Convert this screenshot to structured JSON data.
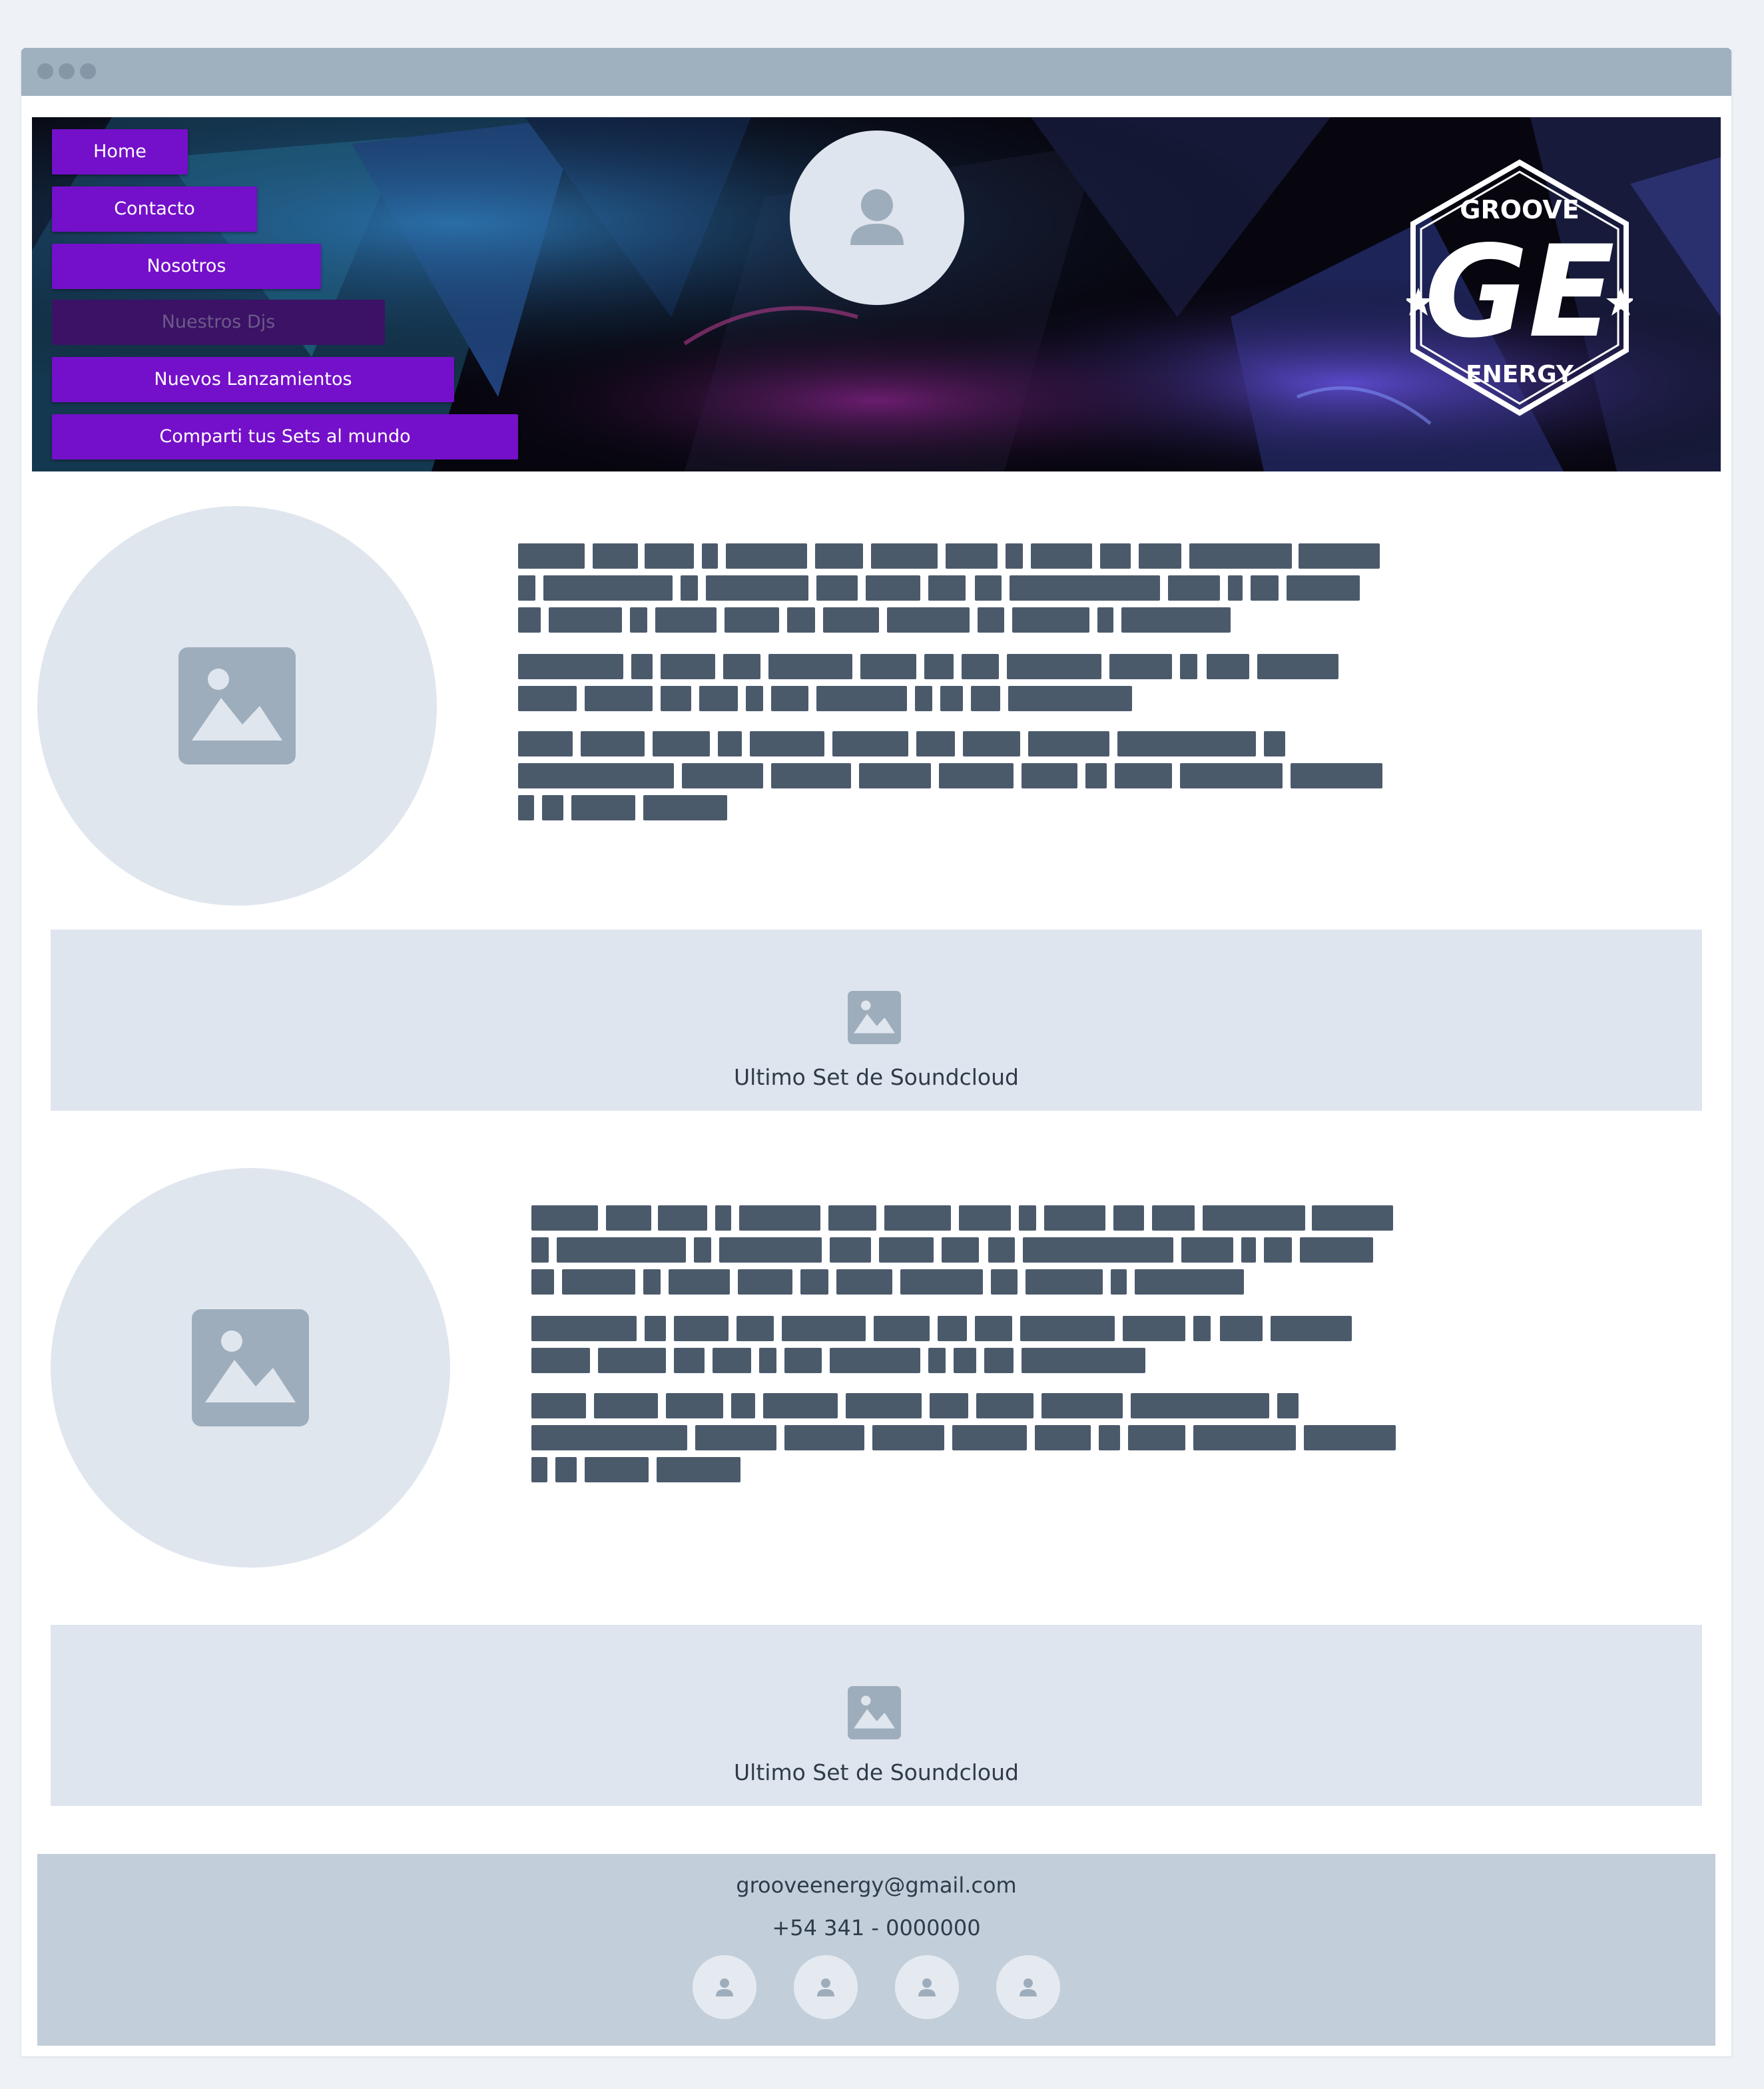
{
  "nav": {
    "items": [
      {
        "label": "Home",
        "state": "normal"
      },
      {
        "label": "Contacto",
        "state": "normal"
      },
      {
        "label": "Nosotros",
        "state": "normal"
      },
      {
        "label": "Nuestros Djs",
        "state": "current"
      },
      {
        "label": "Nuevos Lanzamientos",
        "state": "normal"
      },
      {
        "label": "Comparti tus Sets al mundo",
        "state": "normal"
      }
    ]
  },
  "logo": {
    "top_text": "GROOVE",
    "monogram": "GE",
    "bottom_text": "ENERGY"
  },
  "sections": [
    {
      "embed_label": "Ultimo Set de Soundcloud"
    },
    {
      "embed_label": "Ultimo Set de Soundcloud"
    }
  ],
  "footer": {
    "email": "grooveenergy@gmail.com",
    "phone": "+54 341 - 0000000",
    "social_icons": [
      "user-icon",
      "user-icon",
      "user-icon",
      "user-icon"
    ]
  },
  "colors": {
    "nav_button": "#7410c9",
    "nav_button_current": "#3b1266",
    "placeholder": "#e0e6ee",
    "footer": "#c2ced9",
    "redacted_text": "#4b5a6b"
  }
}
